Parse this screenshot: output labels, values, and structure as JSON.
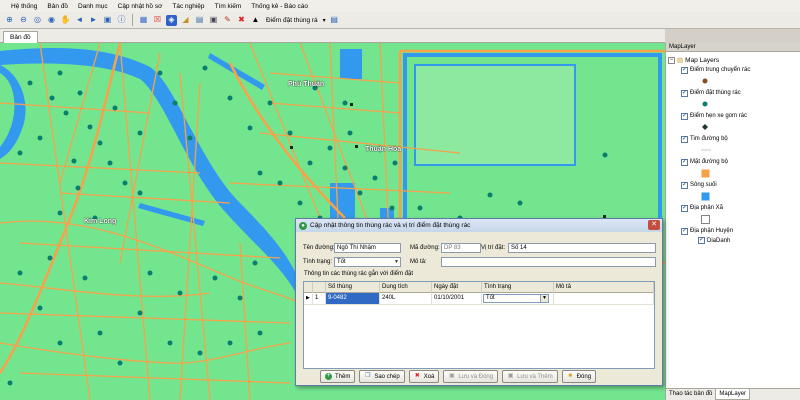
{
  "menu": [
    "Hệ thống",
    "Bản đồ",
    "Danh mục",
    "Cập nhật hồ sơ",
    "Tác nghiệp",
    "Tìm kiếm",
    "Thống kê - Báo cáo"
  ],
  "toolbar": {
    "icons": [
      "zoom-in-icon",
      "zoom-out-icon",
      "zoom-fixed-in-icon",
      "zoom-fixed-out-icon",
      "pan-icon",
      "back-icon",
      "forward-icon",
      "full-extent-icon",
      "identify-icon",
      "select-icon",
      "clear-select-icon",
      "measure-icon",
      "table-icon",
      "save-icon",
      "edit-icon",
      "delete-icon",
      "pointer-icon"
    ],
    "layer_select": "Điểm đặt thùng rá"
  },
  "tabs": {
    "document": "Bản đồ"
  },
  "map": {
    "labels": [
      "Phú Thuận",
      "Thuận Hòa",
      "Kim Long"
    ],
    "colors": {
      "background": "#74e58f",
      "road": "#f6a24a",
      "water": "#3399ee",
      "point": "#0a7f6f"
    }
  },
  "panel": {
    "title": "MapLayer",
    "root": "Map Layers",
    "layers": [
      {
        "name": "Điểm trung chuyển rác",
        "symbol": "brown-dot"
      },
      {
        "name": "Điểm đặt thùng rác",
        "symbol": "teal-dot"
      },
      {
        "name": "Điểm hẹn xe gom rác",
        "symbol": "dark-diamond"
      },
      {
        "name": "Tim đường bộ",
        "symbol": "line"
      },
      {
        "name": "Mặt đường bộ",
        "symbol": "orange-square"
      },
      {
        "name": "Sông suối",
        "symbol": "blue-square"
      },
      {
        "name": "Địa phận Xã",
        "symbol": "white-square"
      },
      {
        "name": "Địa phận Huyện",
        "symbol": "none"
      }
    ],
    "sublabel": "DiaDanh",
    "tabs": [
      "Thao tác bản đồ",
      "MapLayer"
    ]
  },
  "dialog": {
    "title": "Cập nhật thông tin thùng rác và vị trí điểm đặt thùng rác",
    "street_label": "Tên đường:",
    "street_value": "Ngô Thì Nhậm",
    "code_label": "Mã đường:",
    "code_value": "DP 83",
    "position_label": "Vị trí đặt:",
    "position_value": "Số 14",
    "status_label": "Tình trạng:",
    "status_value": "Tốt",
    "desc_label": "Mô tả:",
    "desc_value": "",
    "group_label": "Thông tin các thùng rác gắn với điểm đặt",
    "columns": [
      "Số thùng",
      "Dung tích",
      "Ngày đặt",
      "Tình trạng",
      "Mô tả"
    ],
    "rows": [
      {
        "index": "1",
        "so_thung": "9-0482",
        "dung_tich": "240L",
        "ngay_dat": "01/10/2001",
        "tinh_trang": "Tốt",
        "mo_ta": ""
      }
    ],
    "buttons": [
      {
        "label": "Thêm",
        "enabled": true
      },
      {
        "label": "Sao chép",
        "enabled": true
      },
      {
        "label": "Xoá",
        "enabled": true
      },
      {
        "label": "Lưu và Đóng",
        "enabled": false
      },
      {
        "label": "Lưu và Thêm",
        "enabled": false
      },
      {
        "label": "Đóng",
        "enabled": true
      }
    ]
  }
}
